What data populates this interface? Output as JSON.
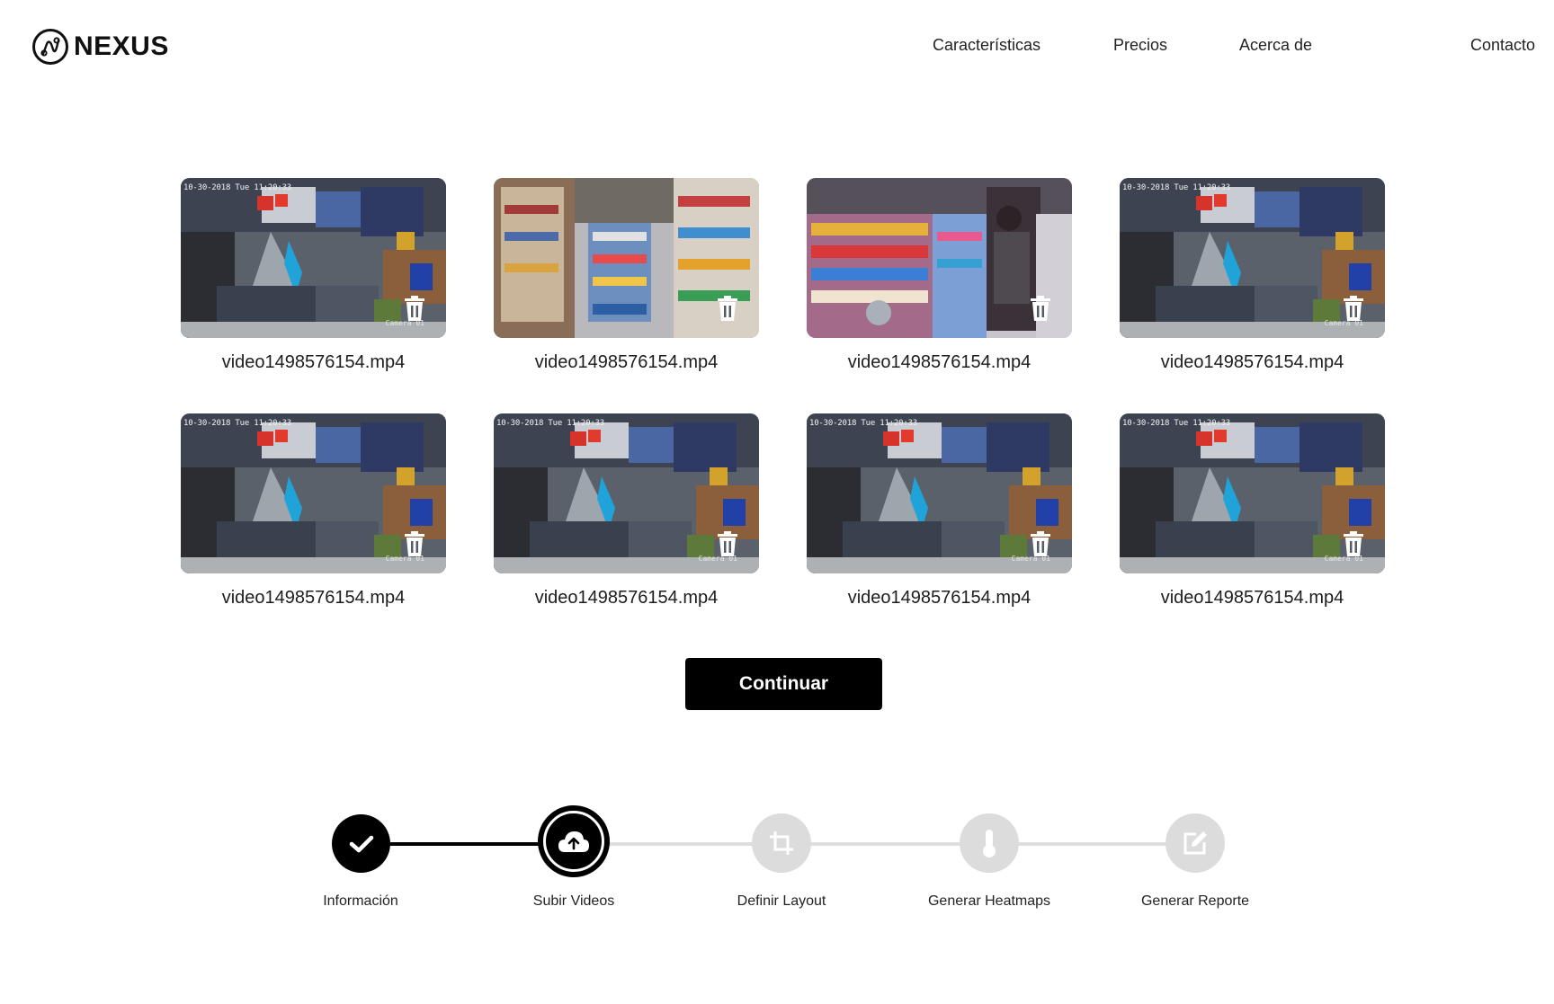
{
  "brand": {
    "name": "NEXUS"
  },
  "nav": {
    "items": [
      {
        "label": "Características"
      },
      {
        "label": "Precios"
      },
      {
        "label": "Acerca de"
      },
      {
        "label": "Contacto"
      }
    ]
  },
  "videos": [
    {
      "filename": "video1498576154.mp4",
      "timestamp": "10-30-2018 Tue 11:20:33",
      "camera": "Camera 01",
      "scene": "clothing-store"
    },
    {
      "filename": "video1498576154.mp4",
      "timestamp": "",
      "camera": "",
      "scene": "convenience-aisle"
    },
    {
      "filename": "video1498576154.mp4",
      "timestamp": "",
      "camera": "",
      "scene": "convenience-counter"
    },
    {
      "filename": "video1498576154.mp4",
      "timestamp": "10-30-2018 Tue 11:20:33",
      "camera": "Camera 01",
      "scene": "clothing-store"
    },
    {
      "filename": "video1498576154.mp4",
      "timestamp": "10-30-2018 Tue 11:20:33",
      "camera": "Camera 01",
      "scene": "clothing-store"
    },
    {
      "filename": "video1498576154.mp4",
      "timestamp": "10-30-2018 Tue 11:20:33",
      "camera": "Camera 01",
      "scene": "clothing-store"
    },
    {
      "filename": "video1498576154.mp4",
      "timestamp": "10-30-2018 Tue 11:20:33",
      "camera": "Camera 01",
      "scene": "clothing-store"
    },
    {
      "filename": "video1498576154.mp4",
      "timestamp": "10-30-2018 Tue 11:20:33",
      "camera": "Camera 01",
      "scene": "clothing-store"
    }
  ],
  "actions": {
    "continue_label": "Continuar"
  },
  "stepper": {
    "steps": [
      {
        "label": "Información",
        "icon": "check-icon",
        "state": "completed"
      },
      {
        "label": "Subir Videos",
        "icon": "cloud-upload-icon",
        "state": "current"
      },
      {
        "label": "Definir Layout",
        "icon": "crop-icon",
        "state": "pending"
      },
      {
        "label": "Generar Heatmaps",
        "icon": "thermometer-icon",
        "state": "pending"
      },
      {
        "label": "Generar Reporte",
        "icon": "edit-icon",
        "state": "pending"
      }
    ]
  },
  "colors": {
    "accent": "#000000",
    "pending": "#d9d9d9",
    "text": "#1a1a1a"
  }
}
